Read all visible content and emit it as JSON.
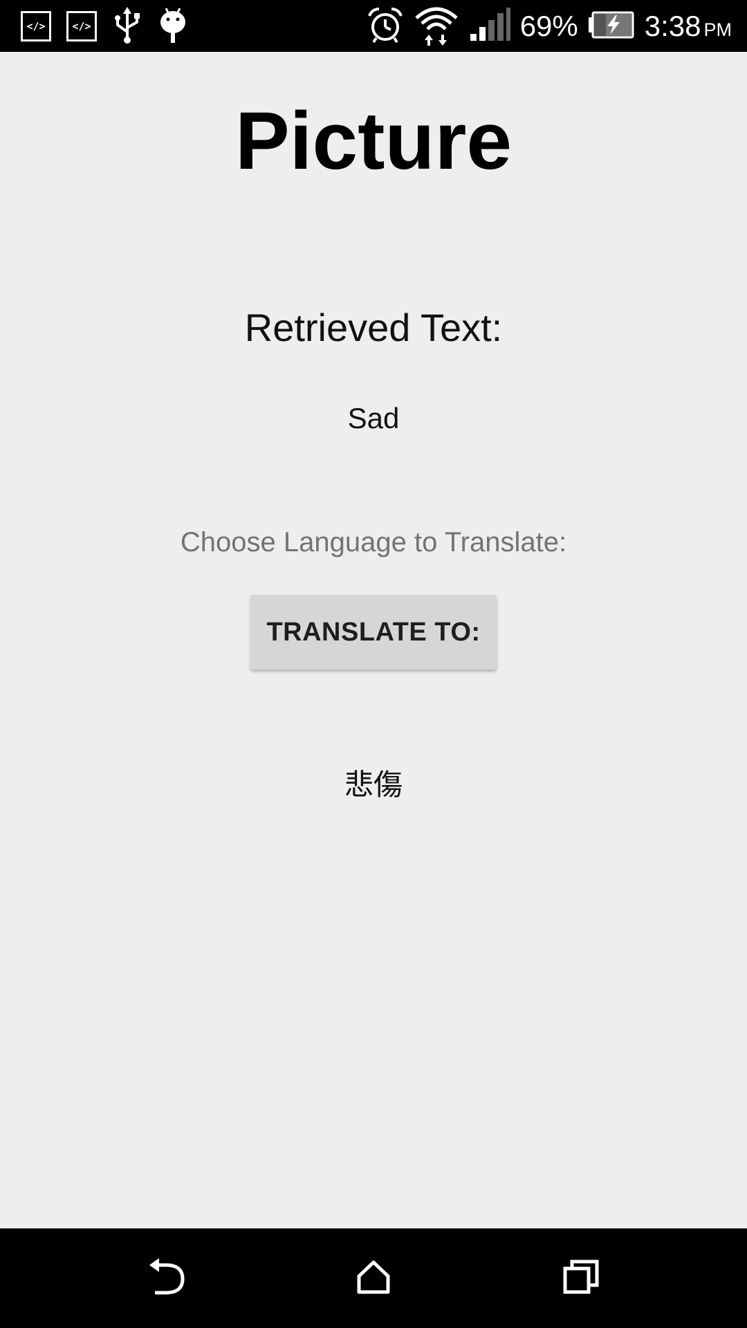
{
  "status_bar": {
    "battery_percent": "69%",
    "time": "3:38",
    "ampm": "PM",
    "notification_icons": [
      "code-icon",
      "code-icon",
      "usb-icon",
      "android-debug-icon"
    ],
    "system_icons": [
      "alarm-icon",
      "wifi-icon",
      "signal-icon",
      "battery-charging-icon"
    ]
  },
  "main": {
    "title": "Picture",
    "retrieved_label": "Retrieved Text:",
    "retrieved_value": "Sad",
    "choose_label": "Choose Language to Translate:",
    "translate_button": "TRANSLATE TO:",
    "translated_value": "悲傷"
  },
  "nav_bar": {
    "buttons": [
      "back-icon",
      "home-icon",
      "recent-apps-icon"
    ]
  },
  "colors": {
    "background": "#eeeeee",
    "status_bar": "#000000",
    "nav_bar": "#000000",
    "button_bg": "#d6d6d6",
    "muted_text": "#737373"
  }
}
